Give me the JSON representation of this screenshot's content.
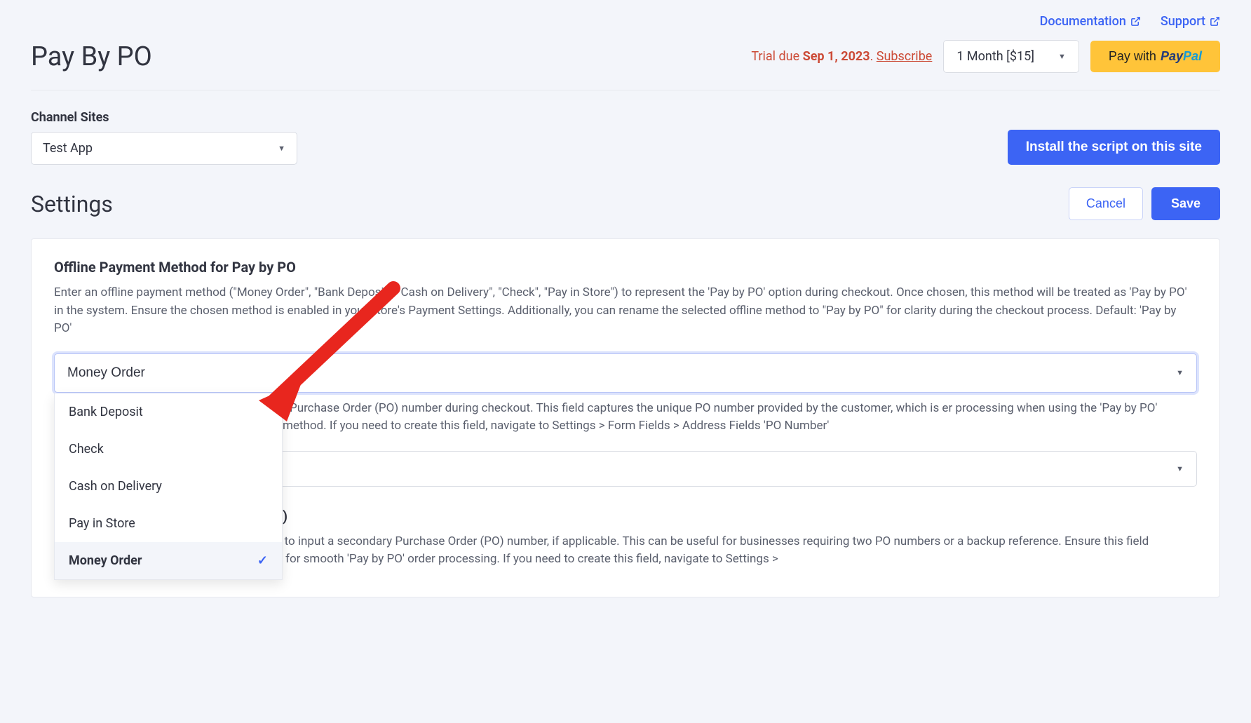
{
  "top_links": {
    "documentation": "Documentation",
    "support": "Support"
  },
  "page_title": "Pay By PO",
  "trial": {
    "prefix": "Trial due ",
    "date": "Sep 1, 2023",
    "suffix": ". ",
    "subscribe": "Subscribe"
  },
  "month_select": "1 Month [$15]",
  "paypal_prefix": "Pay with ",
  "channel": {
    "label": "Channel Sites",
    "value": "Test App"
  },
  "install_btn": "Install the script on this site",
  "settings_title": "Settings",
  "cancel_btn": "Cancel",
  "save_btn": "Save",
  "field1": {
    "title": "Offline Payment Method for Pay by PO",
    "desc": "Enter an offline payment method (\"Money Order\", \"Bank Deposit\", \"Cash on Delivery\", \"Check\", \"Pay in Store\") to represent the 'Pay by PO' option during checkout. Once chosen, this method will be treated as 'Pay by PO' in the system. Ensure the chosen method is enabled in your store's Payment Settings. Additionally, you can rename the selected offline method to \"Pay by PO\" for clarity during the checkout process. Default: 'Pay by PO'",
    "value": "Money Order",
    "options": [
      "Bank Deposit",
      "Check",
      "Cash on Delivery",
      "Pay in Store",
      "Money Order"
    ],
    "selected": "Money Order"
  },
  "field2": {
    "desc_partial": "r Purchase Order (PO) number during checkout. This field captures the unique PO number provided by the customer, which is er processing when using the 'Pay by PO' method. If you need to create this field, navigate to Settings > Form Fields > Address Fields 'PO Number'"
  },
  "field3": {
    "title_partial": ")",
    "desc": "Designate an additional field for customers to input a secondary Purchase Order (PO) number, if applicable. This can be useful for businesses requiring two PO numbers or a backup reference. Ensure this field complements the primary PO Number Field for smooth 'Pay by PO' order processing. If you need to create this field, navigate to Settings >"
  }
}
